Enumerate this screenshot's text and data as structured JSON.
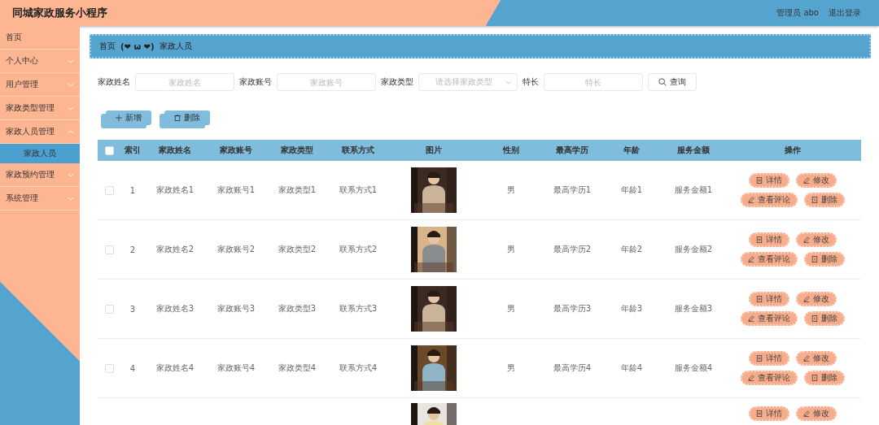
{
  "header": {
    "title": "同城家政服务小程序",
    "user": "管理员 abo",
    "logout": "退出登录"
  },
  "sidebar": {
    "items": [
      {
        "label": "首页",
        "expandable": false,
        "expanded": false,
        "selected": false
      },
      {
        "label": "个人中心",
        "expandable": true,
        "expanded": false,
        "selected": false
      },
      {
        "label": "用户管理",
        "expandable": true,
        "expanded": false,
        "selected": false
      },
      {
        "label": "家政类型管理",
        "expandable": true,
        "expanded": false,
        "selected": false
      },
      {
        "label": "家政人员管理",
        "expandable": true,
        "expanded": true,
        "selected": false,
        "children": [
          {
            "label": "家政人员",
            "selected": true
          }
        ]
      },
      {
        "label": "家政预约管理",
        "expandable": true,
        "expanded": false,
        "selected": false
      },
      {
        "label": "系统管理",
        "expandable": true,
        "expanded": false,
        "selected": false
      }
    ]
  },
  "breadcrumb": {
    "home": "首页",
    "separator": "(❤ ω ❤)",
    "current": "家政人员"
  },
  "search": {
    "fields": [
      {
        "kind": "input",
        "label": "家政姓名",
        "placeholder": "家政姓名"
      },
      {
        "kind": "input",
        "label": "家政账号",
        "placeholder": "家政账号"
      },
      {
        "kind": "select",
        "label": "家政类型",
        "placeholder": "请选择家政类型"
      },
      {
        "kind": "input",
        "label": "特长",
        "placeholder": "特长"
      }
    ],
    "button": "查询"
  },
  "actions": [
    {
      "kind": "add",
      "label": "新增"
    },
    {
      "kind": "delete",
      "label": "删除"
    }
  ],
  "table": {
    "columns": [
      "索引",
      "家政姓名",
      "家政账号",
      "家政类型",
      "联系方式",
      "图片",
      "性别",
      "最高学历",
      "年龄",
      "服务金额",
      "操作"
    ],
    "all_checked": false,
    "rows": [
      {
        "checked": false,
        "cells": [
          "1",
          "家政姓名1",
          "家政账号1",
          "家政类型1",
          "联系方式1"
        ],
        "picture": {
          "kind": "picture"
        },
        "cells2": [
          "男",
          "最高学历1",
          "年龄1",
          "服务金额1"
        ],
        "buttons": [
          {
            "kind": "detail",
            "label": "详情"
          },
          {
            "kind": "edit",
            "label": "修改"
          },
          {
            "kind": "comment",
            "label": "查看评论"
          },
          {
            "kind": "delete",
            "label": "删除"
          }
        ]
      },
      {
        "checked": false,
        "cells": [
          "2",
          "家政姓名2",
          "家政账号2",
          "家政类型2",
          "联系方式2"
        ],
        "picture": {
          "kind": "picture"
        },
        "cells2": [
          "男",
          "最高学历2",
          "年龄2",
          "服务金额2"
        ],
        "buttons": [
          {
            "kind": "detail",
            "label": "详情"
          },
          {
            "kind": "edit",
            "label": "修改"
          },
          {
            "kind": "comment",
            "label": "查看评论"
          },
          {
            "kind": "delete",
            "label": "删除"
          }
        ]
      },
      {
        "checked": false,
        "cells": [
          "3",
          "家政姓名3",
          "家政账号3",
          "家政类型3",
          "联系方式3"
        ],
        "picture": {
          "kind": "picture"
        },
        "cells2": [
          "男",
          "最高学历3",
          "年龄3",
          "服务金额3"
        ],
        "buttons": [
          {
            "kind": "detail",
            "label": "详情"
          },
          {
            "kind": "edit",
            "label": "修改"
          },
          {
            "kind": "comment",
            "label": "查看评论"
          },
          {
            "kind": "delete",
            "label": "删除"
          }
        ]
      },
      {
        "checked": false,
        "cells": [
          "4",
          "家政姓名4",
          "家政账号4",
          "家政类型4",
          "联系方式4"
        ],
        "picture": {
          "kind": "picture"
        },
        "cells2": [
          "男",
          "最高学历4",
          "年龄4",
          "服务金额4"
        ],
        "buttons": [
          {
            "kind": "detail",
            "label": "详情"
          },
          {
            "kind": "edit",
            "label": "修改"
          },
          {
            "kind": "comment",
            "label": "查看评论"
          },
          {
            "kind": "delete",
            "label": "删除"
          }
        ]
      },
      {
        "picture": {
          "kind": "picture"
        },
        "buttons": [
          {
            "kind": "detail",
            "label": "详情"
          },
          {
            "kind": "edit",
            "label": "修改"
          }
        ]
      }
    ]
  }
}
